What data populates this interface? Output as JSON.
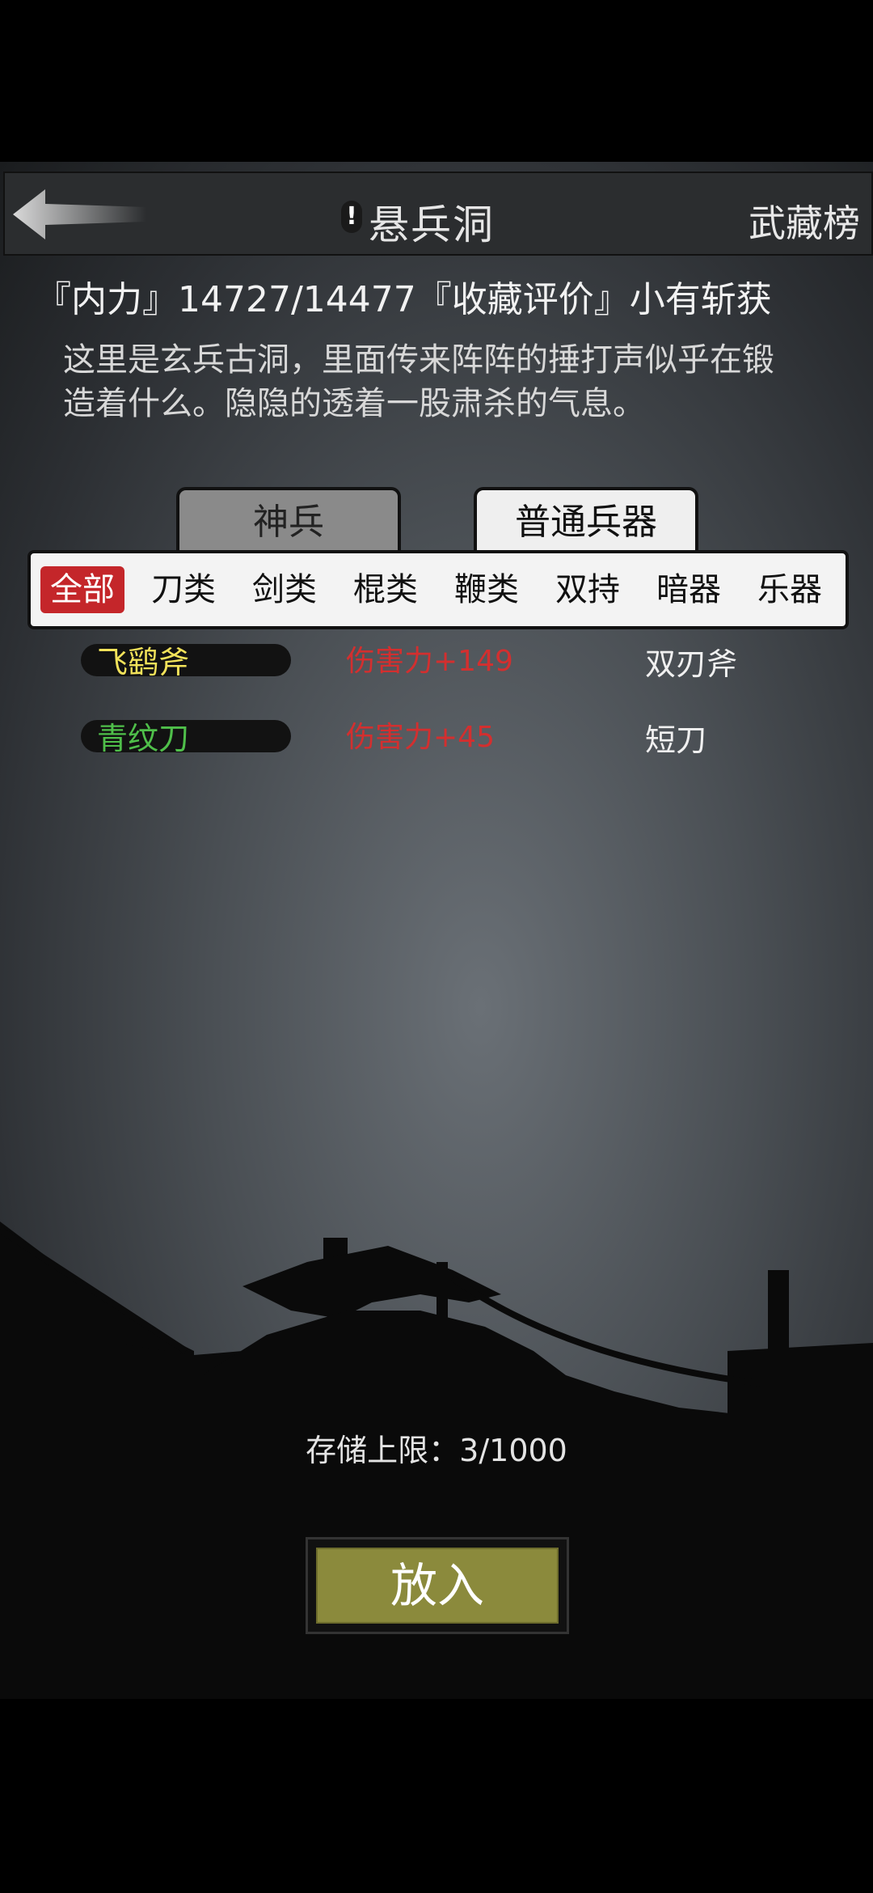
{
  "header": {
    "title": "悬兵洞",
    "alert": "!",
    "rank_link": "武藏榜"
  },
  "stats_line": "『内力』14727/14477『收藏评价』小有斩获",
  "description": "这里是玄兵古洞，里面传来阵阵的捶打声似乎在锻造着什么。隐隐的透着一股肃杀的气息。",
  "tabs": [
    {
      "label": "神兵",
      "active": false
    },
    {
      "label": "普通兵器",
      "active": true
    }
  ],
  "filters": [
    "全部",
    "刀类",
    "剑类",
    "棍类",
    "鞭类",
    "双持",
    "暗器",
    "乐器"
  ],
  "selected_filter": "全部",
  "items": [
    {
      "name": "飞鹞斧",
      "name_color": "#f2e25a",
      "stat": "伤害力+149",
      "type": "双刃斧"
    },
    {
      "name": "青纹刀",
      "name_color": "#4fbf4a",
      "stat": "伤害力+45",
      "type": "短刀"
    }
  ],
  "storage_text": "存储上限：3/1000",
  "put_button": "放入",
  "colors": {
    "filter_selected": "#c4262a",
    "stat_red": "#d32f2f",
    "button_olive": "#8b8a3c"
  }
}
